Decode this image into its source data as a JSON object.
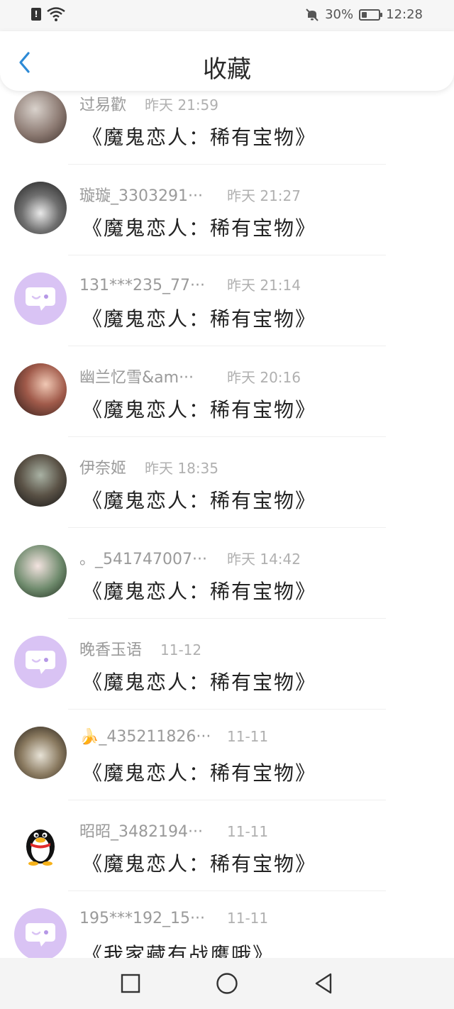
{
  "status_bar": {
    "battery_percent": "30%",
    "battery_level": 0.3,
    "time": "12:28",
    "icons": [
      "sim-alert-icon",
      "wifi-icon",
      "mute-bell-icon",
      "battery-icon"
    ]
  },
  "header": {
    "back_icon": "chevron-left-icon",
    "title": "收藏"
  },
  "items": [
    {
      "name": "过易歡",
      "time": "昨天 21:59",
      "title": "《魔鬼恋人：稀有宝物》",
      "avatar": "photo"
    },
    {
      "name": "璇璇_3303291···",
      "time": "昨天 21:27",
      "title": "《魔鬼恋人：稀有宝物》",
      "avatar": "fan"
    },
    {
      "name": "131***235_77···",
      "time": "昨天 21:14",
      "title": "《魔鬼恋人：稀有宝物》",
      "avatar": "purple"
    },
    {
      "name": "幽兰忆雪&am···",
      "time": "昨天 20:16",
      "title": "《魔鬼恋人：稀有宝物》",
      "avatar": "art"
    },
    {
      "name": "伊奈姬",
      "time": "昨天 18:35",
      "title": "《魔鬼恋人：稀有宝物》",
      "avatar": "dark"
    },
    {
      "name": "。_541747007···",
      "time": "昨天 14:42",
      "title": "《魔鬼恋人：稀有宝物》",
      "avatar": "girl"
    },
    {
      "name": "晚香玉语",
      "time": "11-12",
      "title": "《魔鬼恋人：稀有宝物》",
      "avatar": "purple"
    },
    {
      "name": "🍌_435211826···",
      "time": "11-11",
      "title": "《魔鬼恋人：稀有宝物》",
      "avatar": "dog"
    },
    {
      "name": "昭昭_3482194···",
      "time": "11-11",
      "title": "《魔鬼恋人：稀有宝物》",
      "avatar": "penguin"
    },
    {
      "name": "195***192_15···",
      "time": "11-11",
      "title": "《我家藏有战鹰哦》",
      "avatar": "purple"
    }
  ],
  "nav": {
    "recent_icon": "square-icon",
    "home_icon": "circle-icon",
    "back_icon": "triangle-back-icon"
  }
}
